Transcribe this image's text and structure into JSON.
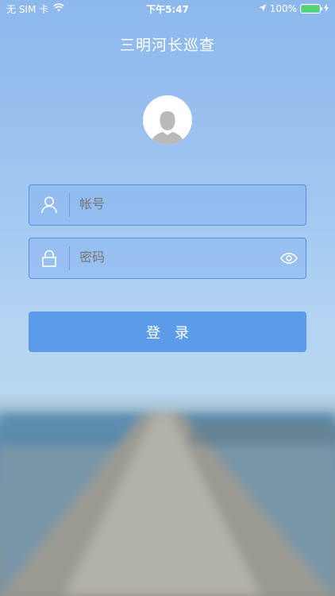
{
  "status_bar": {
    "carrier": "无 SIM 卡",
    "time": "下午5:47",
    "battery_percent": "100%",
    "battery_level": 1.0,
    "battery_color": "#4cd964"
  },
  "app": {
    "title": "三明河长巡查"
  },
  "login": {
    "account_placeholder": "帐号",
    "account_value": "",
    "password_placeholder": "密码",
    "password_value": "",
    "submit_label": "登录",
    "accent_color": "#5b9be8"
  },
  "icons": [
    "wifi-icon",
    "location-arrow-icon",
    "charging-bolt-icon",
    "avatar-icon",
    "user-icon",
    "lock-icon",
    "eye-icon"
  ]
}
